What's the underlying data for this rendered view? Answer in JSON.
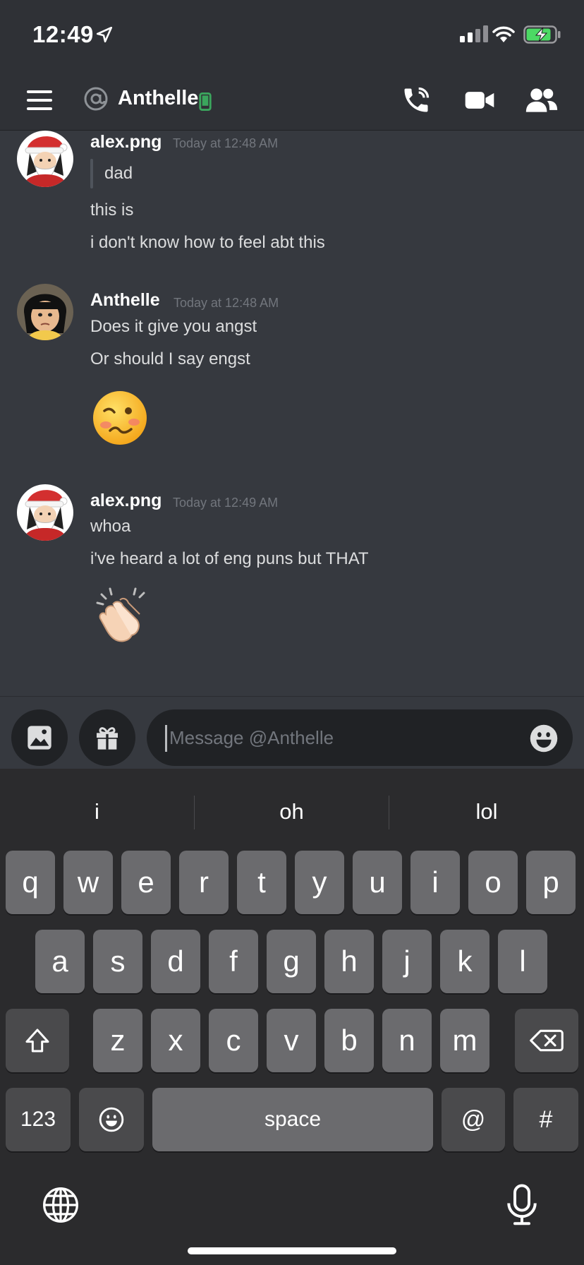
{
  "status_bar": {
    "time": "12:49"
  },
  "header": {
    "name": "Anthelle"
  },
  "messages": [
    {
      "author": "alex.png",
      "timestamp": "Today at 12:48 AM",
      "quote": "dad",
      "lines": [
        "this is",
        "i don't know how to feel abt this"
      ]
    },
    {
      "author": "Anthelle",
      "timestamp": "Today at 12:48 AM",
      "lines": [
        "Does it give you angst",
        "Or should I say engst"
      ],
      "emoji": "woozy-face"
    },
    {
      "author": "alex.png",
      "timestamp": "Today at 12:49 AM",
      "lines": [
        "whoa",
        "i've heard a lot of eng puns but THAT"
      ],
      "emoji": "clapping-hands"
    }
  ],
  "input": {
    "placeholder": "Message @Anthelle"
  },
  "keyboard": {
    "suggestions": [
      "i",
      "oh",
      "lol"
    ],
    "row1": [
      "q",
      "w",
      "e",
      "r",
      "t",
      "y",
      "u",
      "i",
      "o",
      "p"
    ],
    "row2": [
      "a",
      "s",
      "d",
      "f",
      "g",
      "h",
      "j",
      "k",
      "l"
    ],
    "row3": [
      "z",
      "x",
      "c",
      "v",
      "b",
      "n",
      "m"
    ],
    "numbers_label": "123",
    "space_label": "space",
    "at_label": "@",
    "hash_label": "#"
  },
  "colors": {
    "background": "#36393f",
    "header": "#2f3136",
    "online_mobile": "#3ba55d",
    "battery_charge": "#4cd964"
  },
  "icons": [
    "location-arrow-icon",
    "signal-icon",
    "wifi-icon",
    "battery-icon",
    "hamburger-icon",
    "at-icon",
    "mobile-status-icon",
    "call-icon",
    "video-icon",
    "members-icon",
    "image-icon",
    "gift-icon",
    "emoji-icon",
    "shift-icon",
    "backspace-icon",
    "emoji-key-icon",
    "globe-icon",
    "microphone-icon"
  ]
}
